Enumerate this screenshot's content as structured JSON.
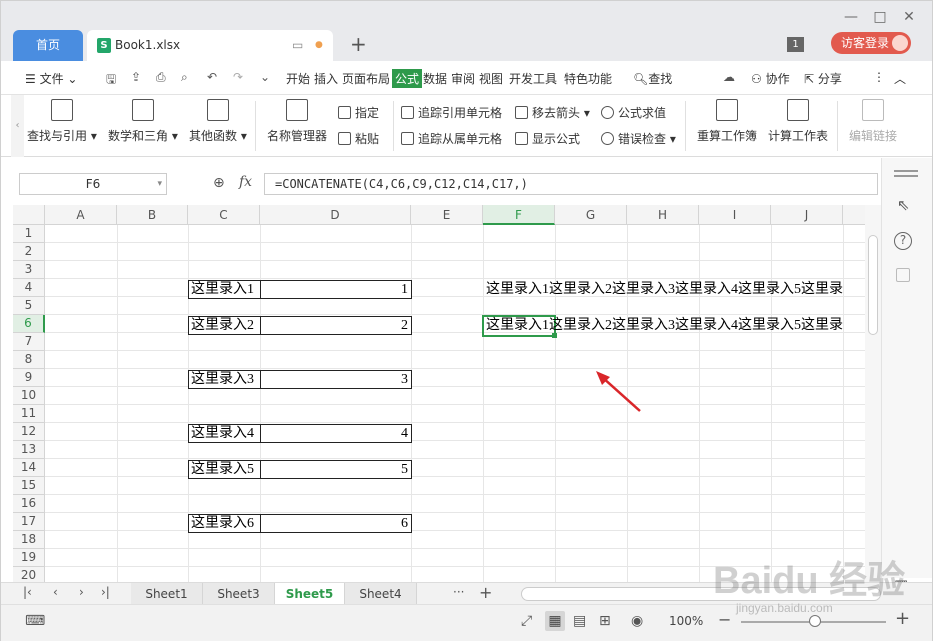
{
  "tabs": {
    "home": "首页",
    "book": "Book1.xlsx",
    "badge": "1",
    "login": "访客登录"
  },
  "menu": {
    "file": "文件",
    "items": [
      "开始",
      "插入",
      "页面布局",
      "公式",
      "数据",
      "审阅",
      "视图",
      "开发工具",
      "特色功能"
    ],
    "search": "查找",
    "collab": "协作",
    "share": "分享"
  },
  "ribbon": {
    "lookup": "查找与引用",
    "math": "数学和三角",
    "other": "其他函数",
    "namemgr": "名称管理器",
    "specify": "指定",
    "paste": "粘贴",
    "trace_prec": "追踪引用单元格",
    "trace_dep": "追踪从属单元格",
    "remove_arrows": "移去箭头",
    "show_formula": "显示公式",
    "eval": "公式求值",
    "errcheck": "错误检查",
    "recalc_book": "重算工作簿",
    "calc_sheet": "计算工作表",
    "edit_links": "编辑链接"
  },
  "formula_bar": {
    "name_box": "F6",
    "fx": "fx",
    "formula": "=CONCATENATE(C4,C6,C9,C12,C14,C17,)"
  },
  "grid": {
    "columns": [
      "A",
      "B",
      "C",
      "D",
      "E",
      "F",
      "G",
      "H",
      "I",
      "J"
    ],
    "rows": [
      "1",
      "2",
      "3",
      "4",
      "5",
      "6",
      "7",
      "8",
      "9",
      "10",
      "11",
      "12",
      "13",
      "14",
      "15",
      "16",
      "17",
      "18",
      "19",
      "20"
    ],
    "c_cells": [
      {
        "row": "4",
        "label": "这里录入1",
        "num": "1"
      },
      {
        "row": "6",
        "label": "这里录入2",
        "num": "2"
      },
      {
        "row": "9",
        "label": "这里录入3",
        "num": "3"
      },
      {
        "row": "12",
        "label": "这里录入4",
        "num": "4"
      },
      {
        "row": "14",
        "label": "这里录入5",
        "num": "5"
      },
      {
        "row": "17",
        "label": "这里录入6",
        "num": "6"
      }
    ],
    "f4": "这里录入1这里录入2这里录入3这里录入4这里录入5这里录",
    "f6": "这里录入1这里录入2这里录入3这里录入4这里录入5这里录"
  },
  "sheets": {
    "s1": "Sheet1",
    "s3": "Sheet3",
    "s5": "Sheet5",
    "s4": "Sheet4"
  },
  "status": {
    "zoom": "100%"
  },
  "watermark": {
    "brand": "Baidu 经验",
    "url": "jingyan.baidu.com"
  },
  "colors": {
    "accent": "#2e9a4b",
    "tab_blue": "#4a8de0",
    "arrow": "#d9262a"
  }
}
